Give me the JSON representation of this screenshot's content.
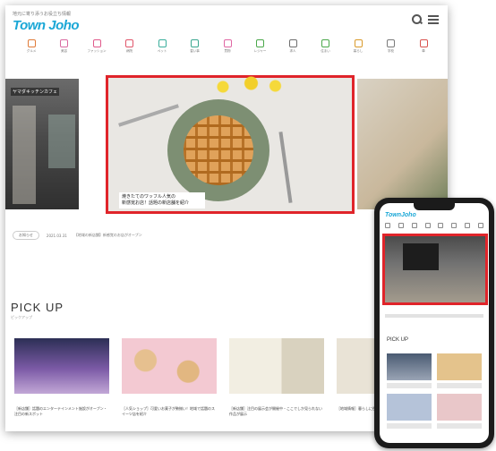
{
  "header": {
    "tagline": "地元に寄り添うお役立ち情報",
    "logo": "Town Joho",
    "icons": [
      "search-icon",
      "menu-icon"
    ]
  },
  "categories": [
    {
      "label": "グルメ",
      "icon": "fork-knife-icon",
      "color": "#e07b39"
    },
    {
      "label": "美容",
      "icon": "lipstick-icon",
      "color": "#d96aa1"
    },
    {
      "label": "ファッション",
      "icon": "tshirt-icon",
      "color": "#e05a8b"
    },
    {
      "label": "病院",
      "icon": "hospital-icon",
      "color": "#e0556a"
    },
    {
      "label": "ペット",
      "icon": "paw-icon",
      "color": "#3aae9c"
    },
    {
      "label": "習い事",
      "icon": "pencil-icon",
      "color": "#3aa68f"
    },
    {
      "label": "買物",
      "icon": "bag-icon",
      "color": "#e066a3"
    },
    {
      "label": "レジャー",
      "icon": "signal-icon",
      "color": "#4aa84a"
    },
    {
      "label": "求人",
      "icon": "share-icon",
      "color": "#6e6e6e"
    },
    {
      "label": "住まい",
      "icon": "house-icon",
      "color": "#4aa84a"
    },
    {
      "label": "暮らし",
      "icon": "hand-icon",
      "color": "#d99a2b"
    },
    {
      "label": "学校",
      "icon": "book-icon",
      "color": "#7a7a7a"
    },
    {
      "label": "車",
      "icon": "car-icon",
      "color": "#d9534f"
    }
  ],
  "carousel": {
    "left_caption": "ヤマダキッチンカフェ",
    "main_caption_line1": "焼きたてのワッフル人気の",
    "main_caption_line2": "新感覚お店！話題の新店舗を紹介",
    "highlight_color": "#e0242a"
  },
  "breadcrumb": {
    "home": "お知らせ",
    "date": "2021.03.31",
    "text": "【地域の新店舗】新感覚のお店がオープン"
  },
  "pickup": {
    "title": "PICK UP",
    "subtitle": "ピックアップ"
  },
  "cards": [
    {
      "title": "［新店舗］話題のエンターテインメント施設がオープン・注目の新スポット"
    },
    {
      "title": "［人気ショップ］可愛いお菓子が勢揃い！地域で話題のスイーツ店を紹介"
    },
    {
      "title": "［新店舗］注目の展示会が開催中・ここでしか見られない作品が展示"
    },
    {
      "title": "［地域情報］暮らしに役立つ情報"
    }
  ],
  "phone": {
    "logo": "TownJoho",
    "pickup": "PICK UP"
  }
}
